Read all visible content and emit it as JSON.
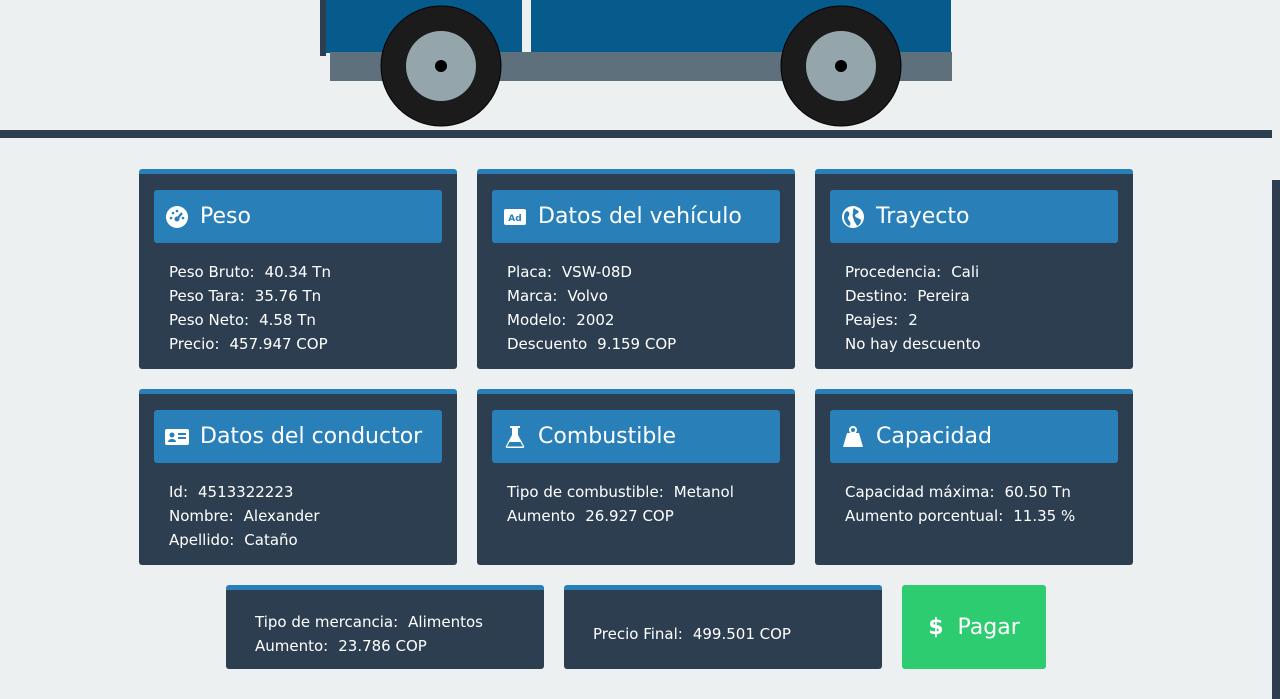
{
  "cards": {
    "peso": {
      "title": "Peso",
      "icon": "gauge-icon",
      "rows": [
        {
          "label": "Peso Bruto:",
          "value": "40.34 Tn"
        },
        {
          "label": "Peso Tara:",
          "value": "35.76 Tn"
        },
        {
          "label": "Peso Neto:",
          "value": "4.58 Tn"
        },
        {
          "label": "Precio:",
          "value": "457.947 COP"
        }
      ]
    },
    "vehiculo": {
      "title": "Datos del vehículo",
      "icon": "ad-icon",
      "icon_text": "Ad",
      "rows": [
        {
          "label": "Placa:",
          "value": "VSW-08D"
        },
        {
          "label": "Marca:",
          "value": "Volvo"
        },
        {
          "label": "Modelo:",
          "value": "2002"
        },
        {
          "label": "Descuento",
          "value": "9.159 COP"
        }
      ]
    },
    "trayecto": {
      "title": "Trayecto",
      "icon": "globe-icon",
      "rows": [
        {
          "label": "Procedencia:",
          "value": "Cali"
        },
        {
          "label": "Destino:",
          "value": "Pereira"
        },
        {
          "label": "Peajes:",
          "value": "2"
        },
        {
          "label": "No hay descuento",
          "value": ""
        }
      ]
    },
    "conductor": {
      "title": "Datos del conductor",
      "icon": "id-card-icon",
      "rows": [
        {
          "label": "Id:",
          "value": "4513322223"
        },
        {
          "label": "Nombre:",
          "value": "Alexander"
        },
        {
          "label": "Apellido:",
          "value": "Cataño"
        }
      ]
    },
    "combustible": {
      "title": "Combustible",
      "icon": "flask-icon",
      "rows": [
        {
          "label": "Tipo de combustible:",
          "value": "Metanol"
        },
        {
          "label": "Aumento",
          "value": "26.927 COP"
        }
      ]
    },
    "capacidad": {
      "title": "Capacidad",
      "icon": "weight-icon",
      "rows": [
        {
          "label": "Capacidad máxima:",
          "value": "60.50 Tn"
        },
        {
          "label": "Aumento porcentual:",
          "value": "11.35 %"
        }
      ]
    }
  },
  "mercancia": {
    "rows": [
      {
        "label": "Tipo de mercancia:",
        "value": "Alimentos"
      },
      {
        "label": "Aumento:",
        "value": "23.786 COP"
      }
    ]
  },
  "precio_final": {
    "label": "Precio Final:",
    "value": "499.501 COP"
  },
  "pay_button": {
    "icon": "dollar-icon",
    "symbol": "$",
    "label": "Pagar"
  },
  "colors": {
    "background": "#ecf0f1",
    "card": "#2c3e50",
    "header": "#2980b9",
    "pay": "#2ecc71",
    "truck_body": "#065a8c",
    "truck_chassis": "#5d707c"
  }
}
